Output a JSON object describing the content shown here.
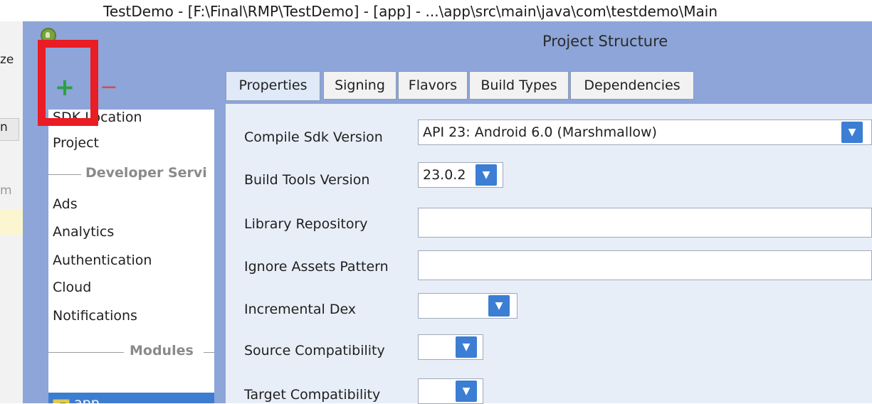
{
  "background": {
    "title_fragment": "TestDemo - [F:\\Final\\RMP\\TestDemo] - [app] - ...\\app\\src\\main\\java\\com\\testdemo\\Main",
    "strip_fragments": [
      "ze",
      "n",
      "m"
    ]
  },
  "dialog": {
    "title": "Project Structure",
    "toolbar": {
      "add_label": "+",
      "remove_label": "−"
    },
    "left_list": {
      "items_top": [
        "SDK Location",
        "Project"
      ],
      "section_developer": "Developer Servi",
      "items_services": [
        "Ads",
        "Analytics",
        "Authentication",
        "Cloud",
        "Notifications"
      ],
      "section_modules": "Modules",
      "selected_module": "app"
    },
    "tabs": [
      "Properties",
      "Signing",
      "Flavors",
      "Build Types",
      "Dependencies"
    ],
    "active_tab": "Properties",
    "fields": {
      "compile_sdk": {
        "label": "Compile Sdk Version",
        "value": "API 23: Android 6.0 (Marshmallow)"
      },
      "build_tools": {
        "label": "Build Tools Version",
        "value": "23.0.2"
      },
      "library_repo": {
        "label": "Library Repository",
        "value": ""
      },
      "ignore_assets": {
        "label": "Ignore Assets Pattern",
        "value": ""
      },
      "incremental_dex": {
        "label": "Incremental Dex",
        "value": ""
      },
      "source_compat": {
        "label": "Source Compatibility",
        "value": ""
      },
      "target_compat": {
        "label": "Target Compatibility",
        "value": ""
      }
    },
    "icons": {
      "dropdown": "▼"
    }
  },
  "colors": {
    "dialog_bg": "#8da5d9",
    "accent": "#3b7ed4",
    "highlight": "#ea1c24",
    "add": "#2ea043",
    "remove": "#e04848"
  }
}
